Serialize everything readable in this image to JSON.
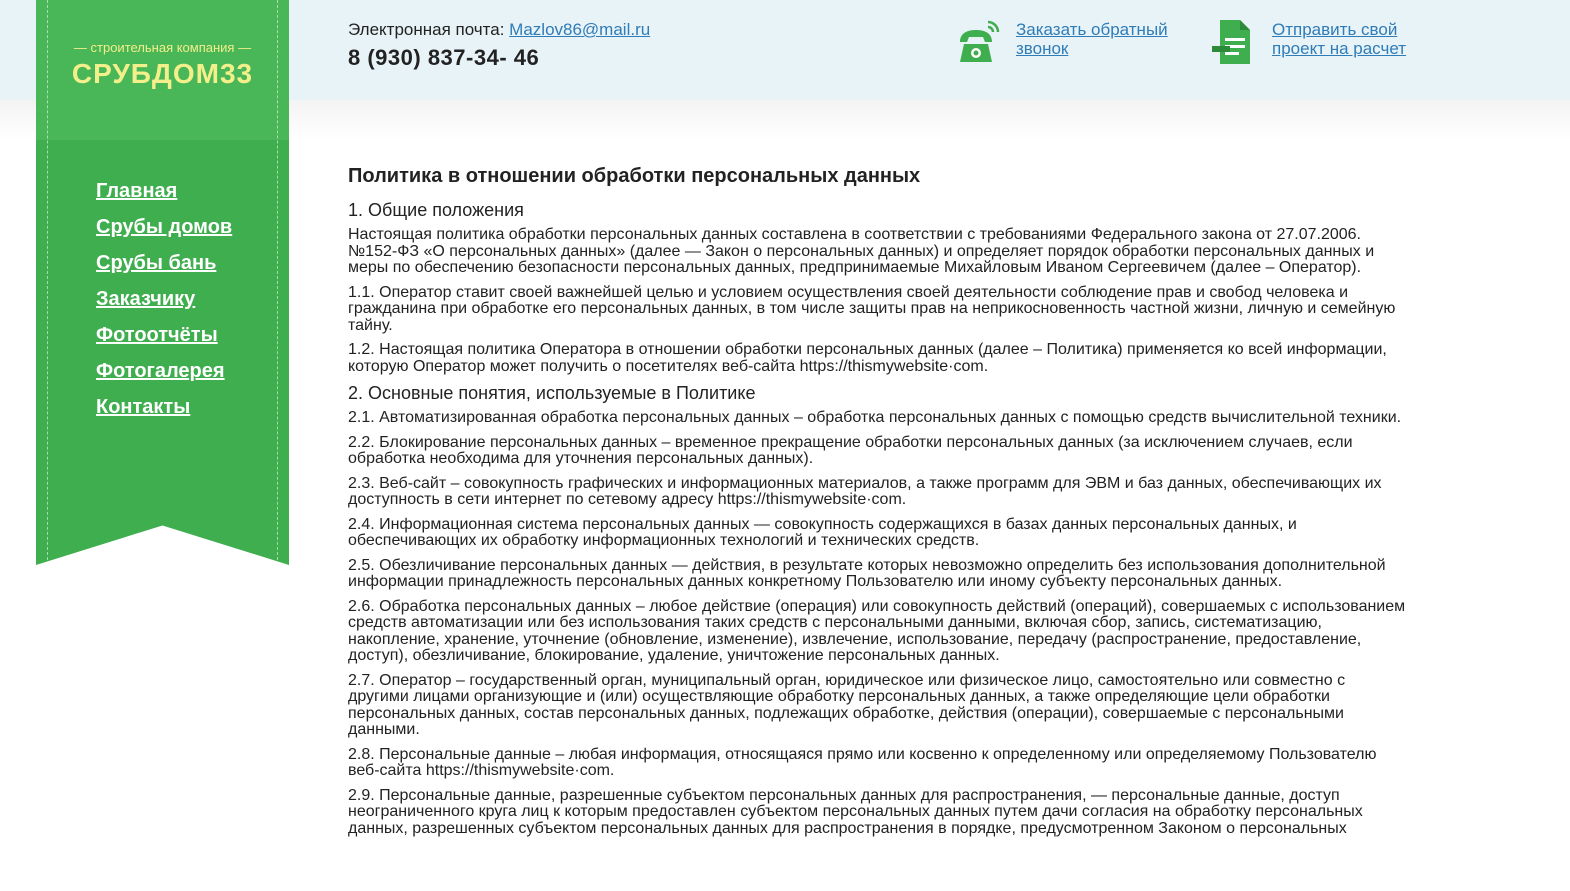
{
  "brand": {
    "tagline": "— строительная компания —",
    "name": "СРУБДОМ33",
    "color": "#3fae4e",
    "logo_color": "#f3ef8a"
  },
  "nav": {
    "items": [
      "Главная",
      "Срубы домов",
      "Срубы бань",
      "Заказчику",
      "Фотоотчёты",
      "Фотогалерея",
      "Контакты"
    ]
  },
  "header": {
    "email_label": "Электронная почта:",
    "email": "Mazlov86@mail.ru",
    "phone": "8 (930) 837-34- 46",
    "callback_icon": "phone-icon",
    "callback_label": "Заказать обратный звонок",
    "project_icon": "document-icon",
    "project_label": "Отправить свой проект на расчет"
  },
  "content": {
    "title": "Политика в отношении обработки персональных данных",
    "section1_heading": "1. Общие положения",
    "section1": [
      "Настоящая политика обработки персональных данных составлена в соответствии с требованиями Федерального закона от 27.07.2006. №152-ФЗ «О персональных данных» (далее — Закон о персональных данных) и определяет порядок обработки персональных данных и меры по обеспечению безопасности персональных данных, предпринимаемые Михайловым Иваном Сергеевичем (далее – Оператор).",
      "1.1. Оператор ставит своей важнейшей целью и условием осуществления своей деятельности соблюдение прав и свобод человека и гражданина при обработке его персональных данных, в том числе защиты прав на неприкосновенность частной жизни, личную и семейную тайну.",
      "1.2. Настоящая политика Оператора в отношении обработки персональных данных (далее – Политика) применяется ко всей информации, которую Оператор может получить о посетителях веб-сайта https://thismywebsite·com."
    ],
    "section2_heading": "2. Основные понятия, используемые в Политике",
    "section2": [
      "2.1. Автоматизированная обработка персональных данных – обработка персональных данных с помощью средств вычислительной техники.",
      "2.2. Блокирование персональных данных – временное прекращение обработки персональных данных (за исключением случаев, если обработка необходима для уточнения персональных данных).",
      "2.3. Веб-сайт – совокупность графических и информационных материалов, а также программ для ЭВМ и баз данных, обеспечивающих их доступность в сети интернет по сетевому адресу https://thismywebsite·com.",
      "2.4. Информационная система персональных данных — совокупность содержащихся в базах данных персональных данных, и обеспечивающих их обработку информационных технологий и технических средств.",
      "2.5. Обезличивание персональных данных — действия, в результате которых невозможно определить без использования дополнительной информации принадлежность персональных данных конкретному Пользователю или иному субъекту персональных данных.",
      "2.6. Обработка персональных данных – любое действие (операция) или совокупность действий (операций), совершаемых с использованием средств автоматизации или без использования таких средств с персональными данными, включая сбор, запись, систематизацию, накопление, хранение, уточнение (обновление, изменение), извлечение, использование, передачу (распространение, предоставление, доступ), обезличивание, блокирование, удаление, уничтожение персональных данных.",
      "2.7. Оператор – государственный орган, муниципальный орган, юридическое или физическое лицо, самостоятельно или совместно с другими лицами организующие и (или) осуществляющие обработку персональных данных, а также определяющие цели обработки персональных данных, состав персональных данных, подлежащих обработке, действия (операции), совершаемые с персональными данными.",
      "2.8. Персональные данные – любая информация, относящаяся прямо или косвенно к определенному или определяемому Пользователю веб-сайта https://thismywebsite·com.",
      "2.9. Персональные данные, разрешенные субъектом персональных данных для распространения, — персональные данные, доступ неограниченного круга лиц к которым предоставлен субъектом персональных данных путем дачи согласия на обработку персональных данных, разрешенных субъектом персональных данных для распространения в порядке, предусмотренном Законом о персональных"
    ]
  }
}
